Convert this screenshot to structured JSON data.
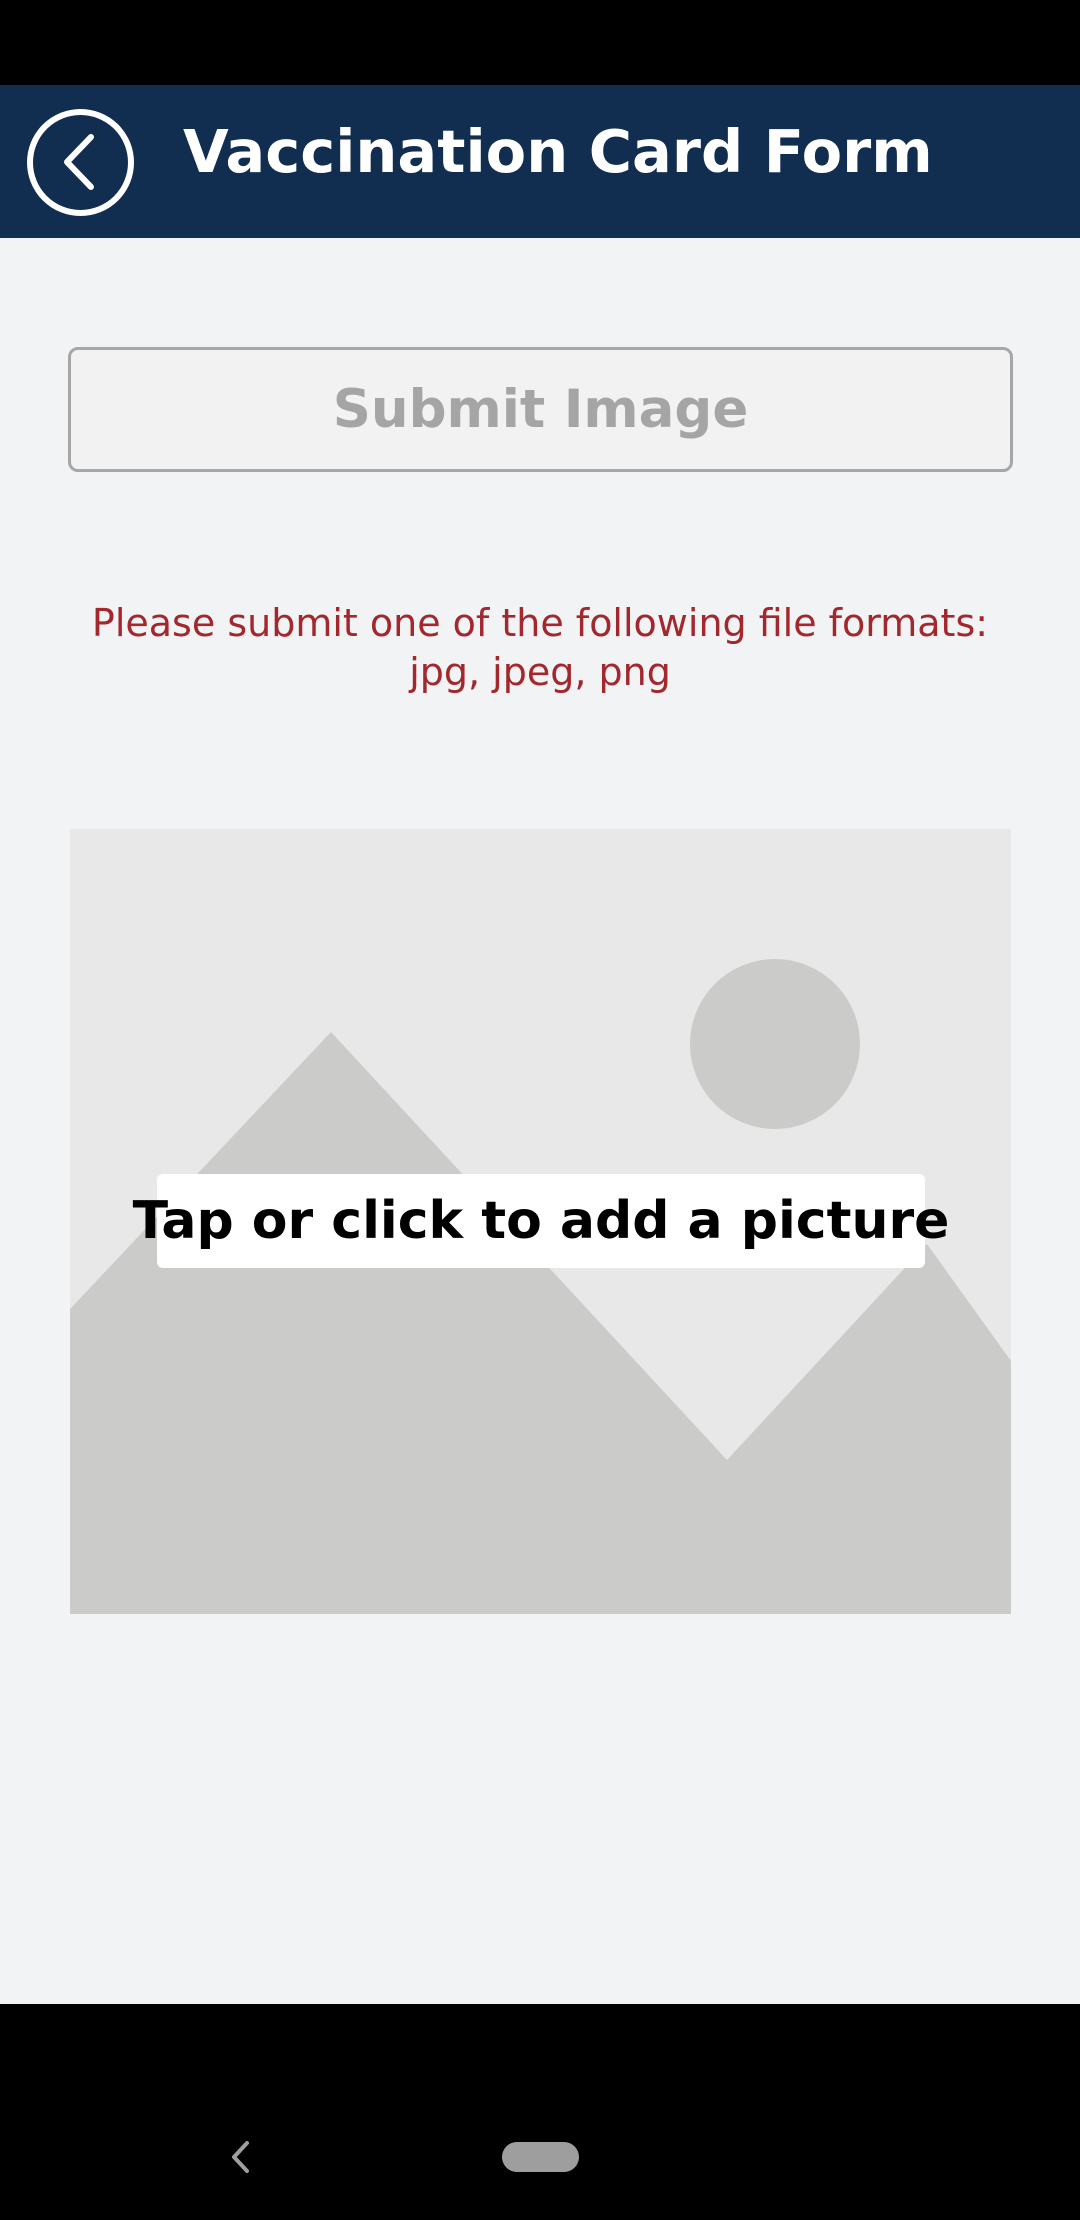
{
  "header": {
    "title": "Vaccination Card Form",
    "back_icon": "chevron-left-circle-icon"
  },
  "form": {
    "submit_label": "Submit Image",
    "format_notice_line1": "Please submit one of the following file formats:",
    "format_notice_line2": "jpg, jpeg, png",
    "add_picture_label": "Tap or click to add a picture",
    "placeholder_icon": "image-placeholder-icon"
  },
  "colors": {
    "header_bg": "#112e51",
    "content_bg": "#f2f3f5",
    "notice_text": "#a3282d",
    "disabled_text": "#a5a5a5"
  },
  "navigation": {
    "back_icon": "nav-back-icon",
    "home_icon": "nav-home-pill-icon"
  }
}
